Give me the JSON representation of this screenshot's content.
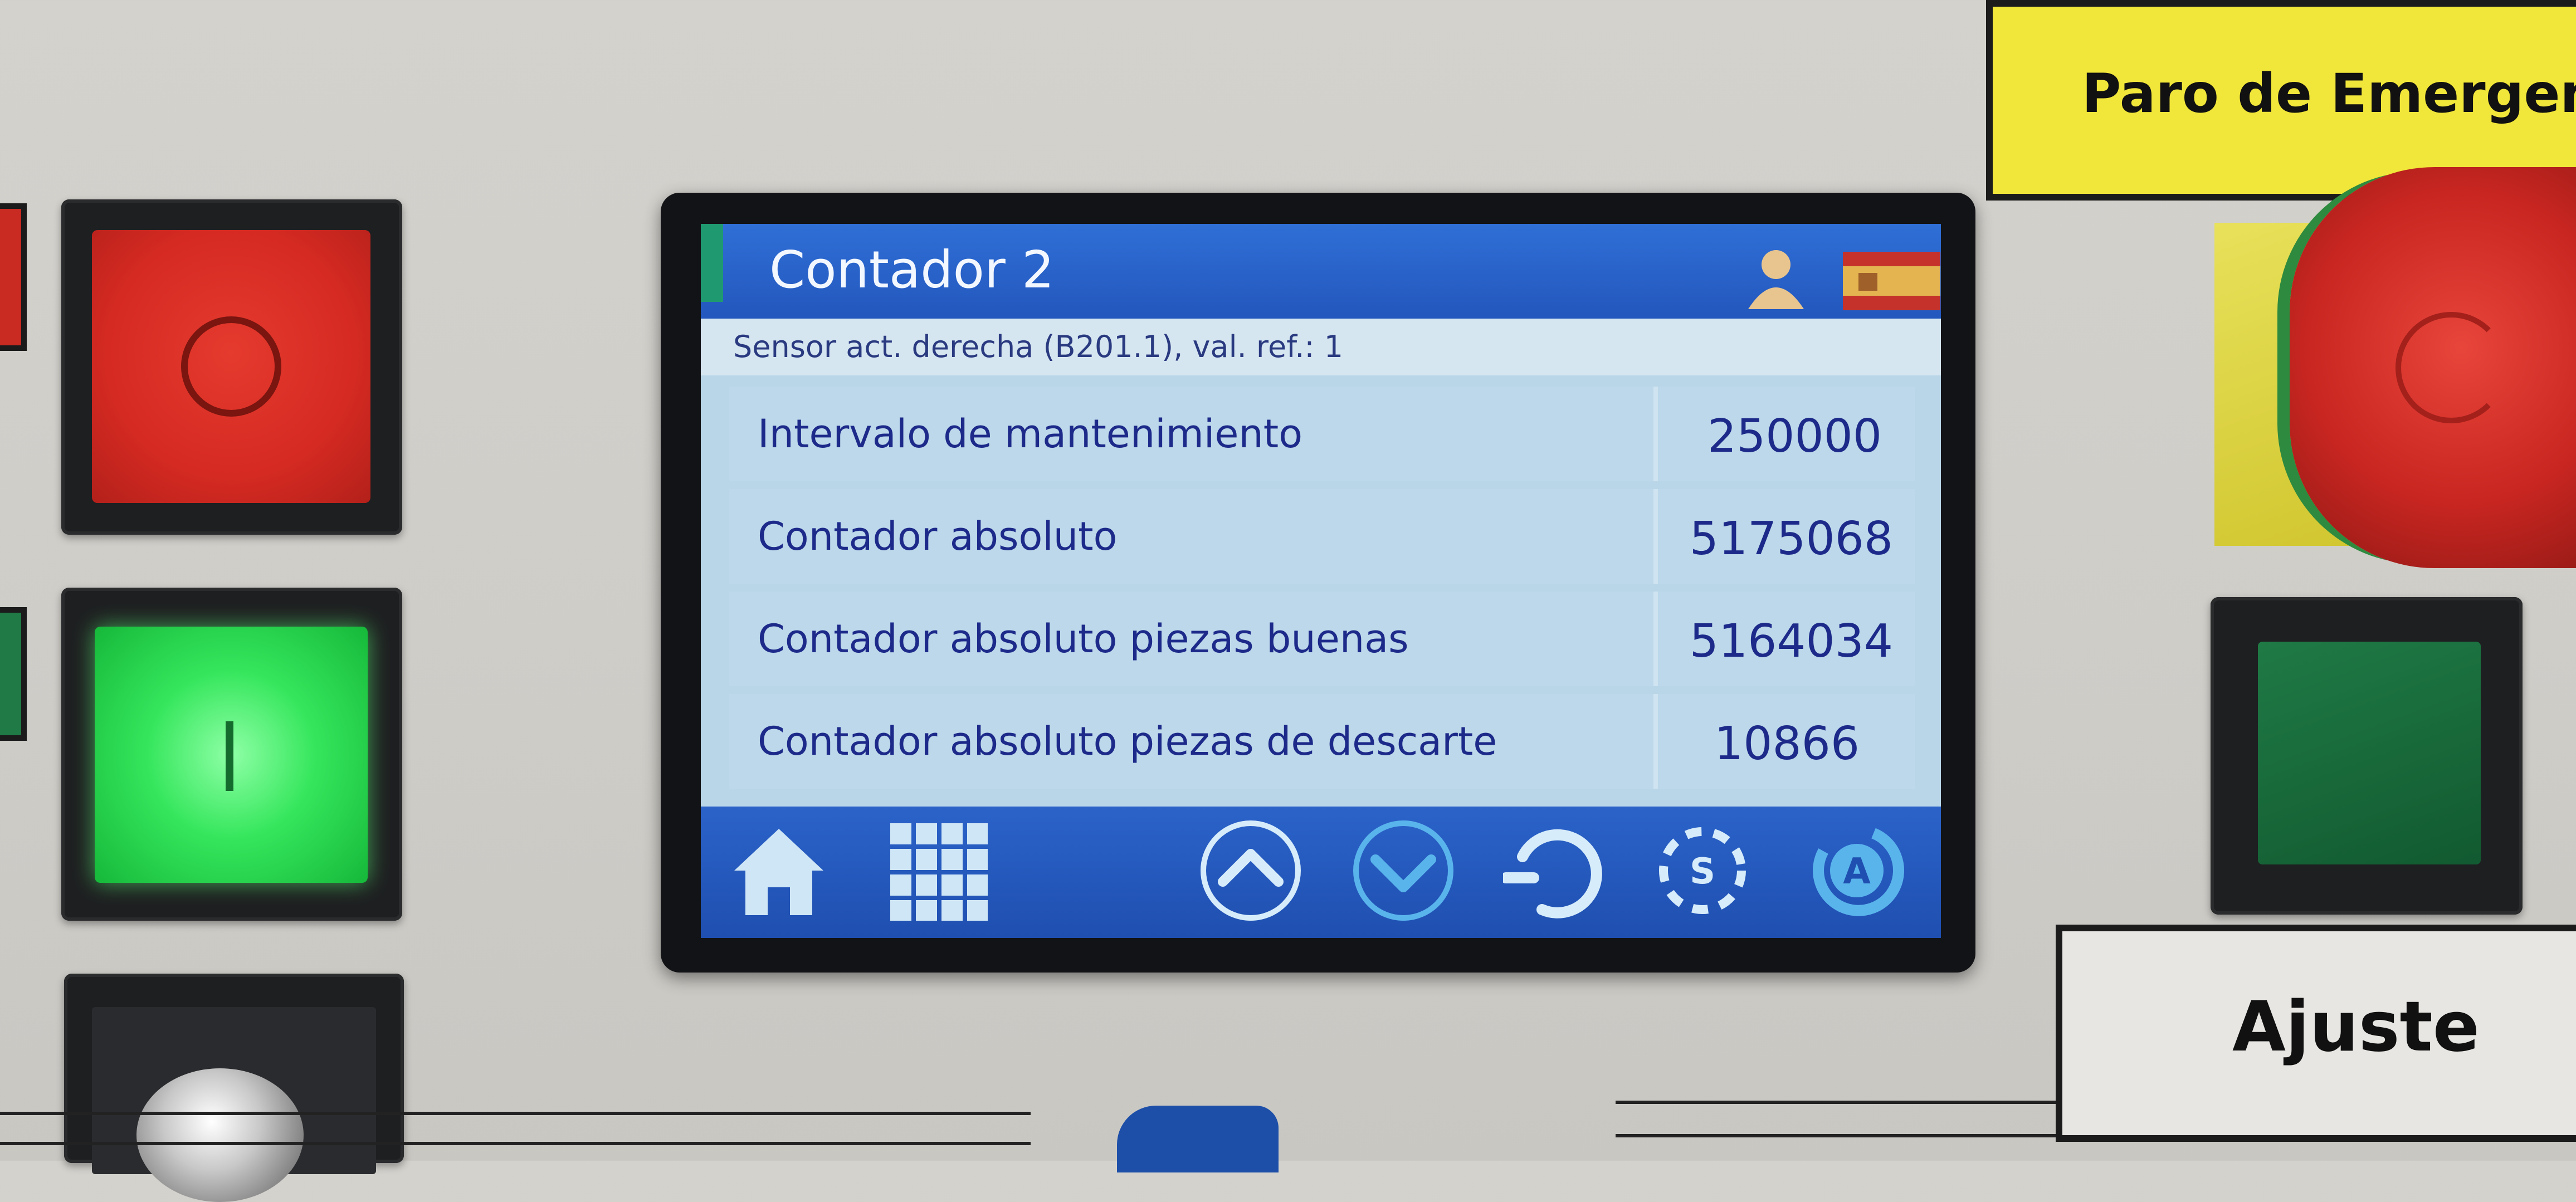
{
  "hmi": {
    "title": "Contador 2",
    "subtitle": "Sensor act. derecha (B201.1), val. ref.: 1",
    "rows": [
      {
        "label": "Intervalo de mantenimiento",
        "value": "250000"
      },
      {
        "label": "Contador absoluto",
        "value": "5175068"
      },
      {
        "label": "Contador absoluto piezas buenas",
        "value": "5164034"
      },
      {
        "label": "Contador absoluto piezas de descarte",
        "value": "10866"
      }
    ],
    "toolbar": [
      "home-icon",
      "grid-menu-icon",
      "arrow-up-icon",
      "arrow-down-icon",
      "refresh-icon",
      "s-cycle-icon",
      "a-cycle-icon"
    ]
  },
  "panel": {
    "emergency_label": "Paro de Emergencia",
    "adjust_label": "Ajuste",
    "stop_symbol": "O",
    "start_symbol": "I"
  },
  "colors": {
    "title_bar": "#2357bd",
    "screen_bg": "#b9d6e8",
    "text": "#1d2a8a",
    "stop_button": "#d52a22",
    "start_button": "#35e65c"
  }
}
